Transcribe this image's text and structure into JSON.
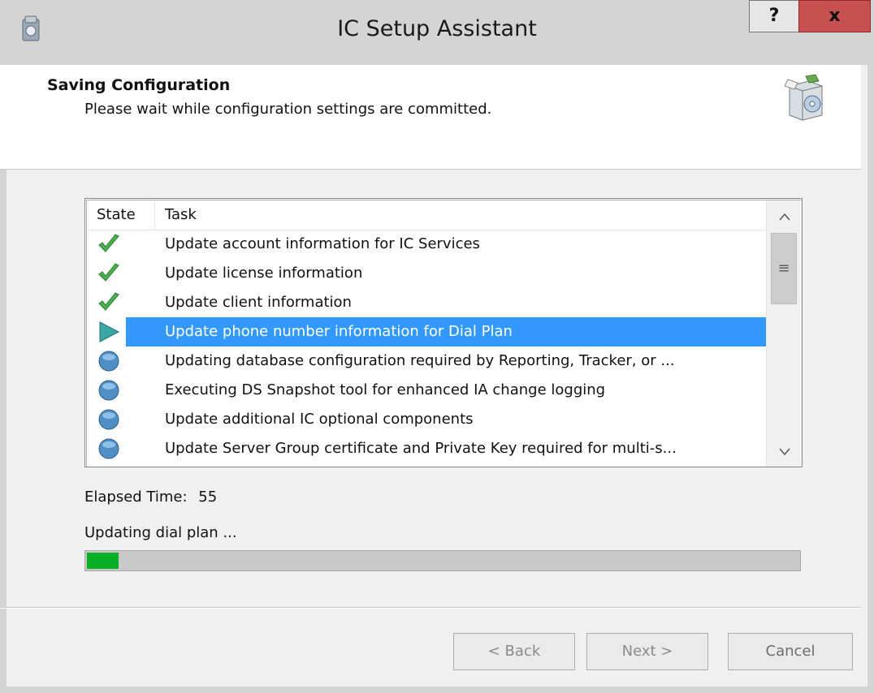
{
  "window": {
    "title": "IC Setup Assistant",
    "help_label": "?",
    "close_label": "x"
  },
  "header": {
    "title": "Saving Configuration",
    "subtitle": "Please wait while configuration settings are committed."
  },
  "task_list": {
    "columns": {
      "state": "State",
      "task": "Task"
    },
    "rows": [
      {
        "state": "completed",
        "task": "Update account information for IC Services"
      },
      {
        "state": "completed",
        "task": "Update license information"
      },
      {
        "state": "completed",
        "task": "Update client information"
      },
      {
        "state": "in-progress",
        "task": "Update phone number information for Dial Plan"
      },
      {
        "state": "pending",
        "task": "Updating database configuration required by Reporting, Tracker, or ..."
      },
      {
        "state": "pending",
        "task": "Executing DS Snapshot tool for enhanced IA change logging"
      },
      {
        "state": "pending",
        "task": "Update additional IC optional components"
      },
      {
        "state": "pending",
        "task": "Update Server Group certificate and Private Key required for multi-s..."
      }
    ],
    "selected_index": 3,
    "scroll_up_label": "^",
    "scroll_down_label": "v",
    "scroll_grip_label": "≡"
  },
  "status": {
    "elapsed_label": "Elapsed Time:",
    "elapsed_value": "55",
    "message": "Updating dial plan ...",
    "progress_fraction": 0.045
  },
  "buttons": {
    "back": "< Back",
    "next": "Next >",
    "cancel": "Cancel"
  },
  "colors": {
    "selection": "#3399ff",
    "progress": "#06b025",
    "close_button": "#c75050"
  }
}
